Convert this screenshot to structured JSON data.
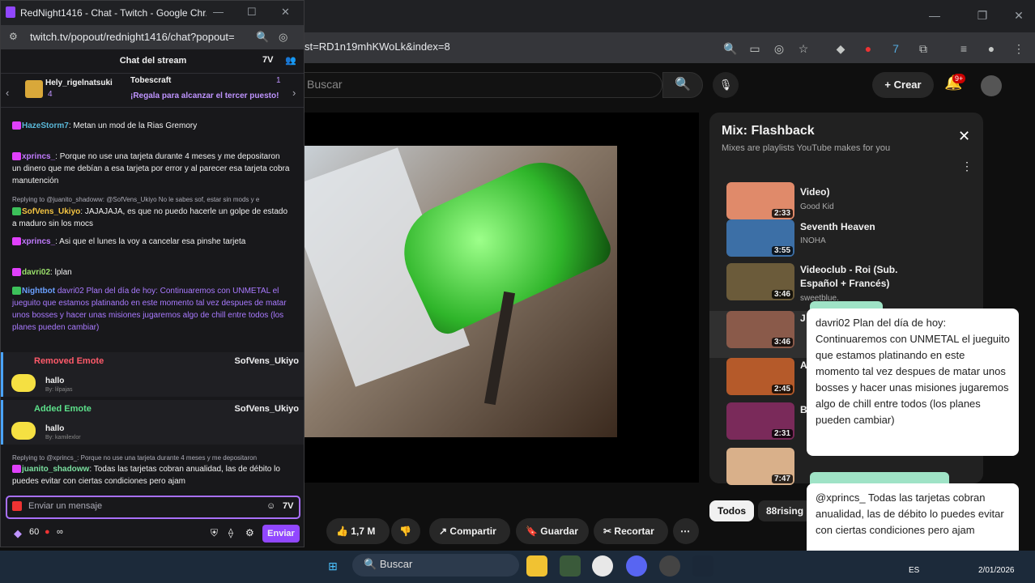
{
  "browser_bg": {
    "url": "st=RD1n19mhKWoLk&index=8"
  },
  "youtube": {
    "search_placeholder": "Buscar",
    "create_label": "Crear",
    "notif_count": "9+",
    "playlist": {
      "title": "Mix: Flashback",
      "subtitle": "Mixes are playlists YouTube makes for you",
      "items": [
        {
          "title": "Video)",
          "channel": "Good Kid",
          "duration": "2:33"
        },
        {
          "title": "Seventh Heaven",
          "channel": "INOHA",
          "duration": "3:55"
        },
        {
          "title": "Videoclub - Roi (Sub. Español + Francés)",
          "channel": "sweetblue.",
          "duration": "3:46"
        },
        {
          "title": "J",
          "channel": "",
          "duration": "3:46"
        },
        {
          "title": "A",
          "channel": "",
          "duration": "2:45"
        },
        {
          "title": "B",
          "channel": "",
          "duration": "2:31"
        },
        {
          "title": "",
          "channel": "",
          "duration": "7:47"
        }
      ]
    },
    "pills": [
      "Todos",
      "88rising"
    ],
    "actions": {
      "likes": "1,7 M",
      "share": "Compartir",
      "save": "Guardar",
      "clip": "Recortar"
    }
  },
  "overlay": {
    "card1_text": "davri02 Plan del día de hoy: Continuaremos con UNMETAL el jueguito que estamos platinando en este momento  tal vez despues de matar unos bosses y hacer unas misiones jugaremos algo de chill entre todos  (los planes pueden cambiar)",
    "card2_text": "@xprincs_ Todas las tarjetas cobran anualidad, las de débito lo puedes evitar con ciertas condiciones pero ajam"
  },
  "taskbar": {
    "search": "Buscar",
    "lang": "ES",
    "date": "2/01/2026"
  },
  "chat": {
    "window_title": "RedNight1416 - Chat - Twitch - Google Chr...",
    "url": "twitch.tv/popout/rednight1416/chat?popout=",
    "header": "Chat del stream",
    "gift": {
      "user1": "Hely_rigelnatsuki",
      "count1": "4",
      "user2": "Tobescraft",
      "count2": "1",
      "promo": "¡Regala para alcanzar el tercer puesto!"
    },
    "messages": [
      {
        "user": "HazeStorm7",
        "color": "#5ab8d9",
        "text": "Metan un mod de la Rias Gremory"
      },
      {
        "user": "xprincs_",
        "color": "#c27cff",
        "text": "Porque no use una tarjeta durante 4 meses y me depositaron un dinero que me debían a esa tarjeta por error y al parecer esa tarjeta cobra manutención"
      },
      {
        "reply": "Replying to @juanito_shadoww: @SofVens_Ukiyo No le sabes sof, estar sin mods y e"
      },
      {
        "user": "SofVens_Ukiyo",
        "color": "#f5c542",
        "text": "JAJAJAJA, es que no puedo hacerle un golpe de estado a maduro sin los mocs"
      },
      {
        "user": "xprincs_",
        "color": "#c27cff",
        "text": "Asi que el lunes la voy a cancelar esa pinshe tarjeta"
      },
      {
        "user": "davri02",
        "color": "#9adf6b",
        "text": "lplan"
      },
      {
        "user": "Nightbot",
        "color": "#6aa0ff",
        "text": "davri02 Plan del día de hoy: Continuaremos con UNMETAL el jueguito que estamos platinando en este momento tal vez despues de matar unos bosses y hacer unas misiones jugaremos algo de chill entre todos (los planes pueden cambiar)"
      }
    ],
    "events": [
      {
        "title": "Removed Emote",
        "user": "SofVens_Ukiyo",
        "emote": "hallo",
        "by": "By: lilpajas"
      },
      {
        "title": "Added Emote",
        "user": "SofVens_Ukiyo",
        "emote": "hallo",
        "by": "By: kamilexlor"
      }
    ],
    "last_reply": "Replying to @xprincs_: Porque no use una tarjeta durante 4 meses y me depositaron",
    "last": {
      "user": "juanito_shadoww",
      "color": "#7be0a0",
      "text": "Todas las tarjetas cobran anualidad, las de débito lo puedes evitar con ciertas condiciones pero ajam"
    },
    "input_placeholder": "Enviar un mensaje",
    "points": "60",
    "points2": "∞",
    "send_label": "Enviar"
  }
}
